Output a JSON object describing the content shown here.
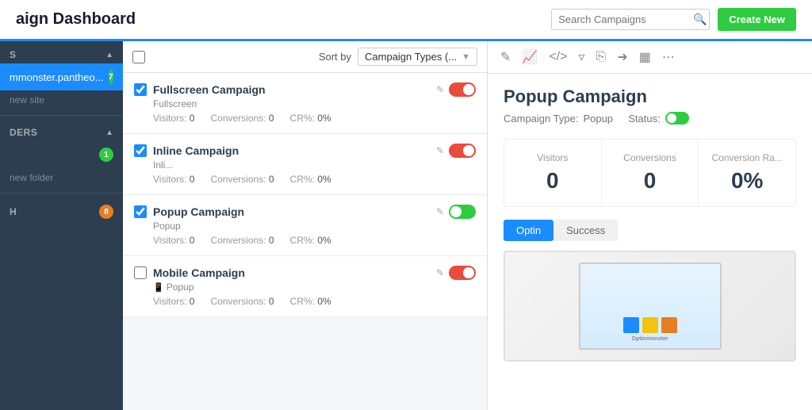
{
  "app": {
    "title": "aign Dashboard",
    "search_placeholder": "Search Campaigns",
    "create_button": "Create New"
  },
  "sidebar": {
    "sections": [
      {
        "id": "sites",
        "label": "s",
        "collapsed": false,
        "items": [
          {
            "id": "site1",
            "label": "mmonster.pantheo...",
            "badge": "7",
            "badge_color": "green",
            "active": true
          }
        ],
        "new_link": "new site"
      },
      {
        "id": "folders",
        "label": "ders",
        "collapsed": false,
        "items": [
          {
            "id": "folder1",
            "label": "",
            "badge": "1",
            "badge_color": "green",
            "active": false
          }
        ],
        "new_link": "new folder"
      },
      {
        "id": "trash",
        "label": "h",
        "collapsed": false,
        "items": [],
        "badge": "8",
        "badge_color": "orange"
      }
    ]
  },
  "campaign_list": {
    "sort_label": "Sort by",
    "sort_value": "Campaign Types (...",
    "campaigns": [
      {
        "id": 1,
        "name": "Fullscreen Campaign",
        "type": "Fullscreen",
        "checked": true,
        "toggle": "on",
        "visitors": 0,
        "conversions": 0,
        "cr": "0%"
      },
      {
        "id": 2,
        "name": "Inline Campaign",
        "type": "Inli...",
        "checked": true,
        "toggle": "on",
        "visitors": 0,
        "conversions": 0,
        "cr": "0%"
      },
      {
        "id": 3,
        "name": "Popup Campaign",
        "type": "Popup",
        "checked": true,
        "toggle": "green",
        "visitors": 0,
        "conversions": 0,
        "cr": "0%"
      },
      {
        "id": 4,
        "name": "Mobile Campaign",
        "type": "Popup",
        "mobile_icon": true,
        "checked": false,
        "toggle": "on",
        "visitors": 0,
        "conversions": 0,
        "cr": "0%"
      }
    ],
    "stats_labels": {
      "visitors": "Visitors:",
      "conversions": "Conversions:",
      "cr": "CR%:"
    }
  },
  "detail": {
    "campaign_name": "Popup Campaign",
    "campaign_type_label": "Campaign Type:",
    "campaign_type_value": "Popup",
    "status_label": "Status:",
    "stats": [
      {
        "label": "Visitors",
        "value": "0"
      },
      {
        "label": "Conversions",
        "value": "0"
      },
      {
        "label": "Conversion Ra...",
        "value": "0%"
      }
    ],
    "tabs": [
      {
        "label": "Optin",
        "active": true
      },
      {
        "label": "Success",
        "active": false
      }
    ],
    "toolbar_icons": [
      "edit-icon",
      "chart-icon",
      "code-icon",
      "filter-icon",
      "copy-icon",
      "share-icon",
      "grid-icon",
      "more-icon"
    ]
  }
}
